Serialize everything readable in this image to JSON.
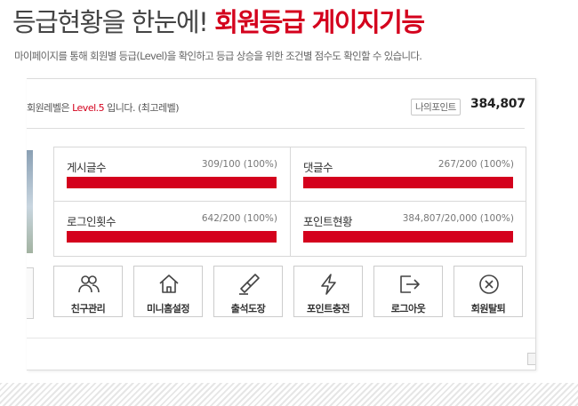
{
  "header": {
    "title_normal": "등급현황을 한눈에!",
    "title_accent": "회원등급 게이지기능",
    "subtitle": "마이페이지를 통해 회원별 등급(Level)을 확인하고 등급 상승을 위한 조건별 점수도 확인할 수 있습니다.",
    "accent_color": "#d4011d"
  },
  "member": {
    "level_prefix": "회원레벨은 ",
    "level_value": "Level.5",
    "level_suffix": " 입니다. (최고레벨)",
    "points_label": "나의포인트",
    "points_value": "384,807"
  },
  "stats": [
    {
      "label": "게시글수",
      "value": "309/100 (100%)",
      "percent": 100
    },
    {
      "label": "댓글수",
      "value": "267/200 (100%)",
      "percent": 100
    },
    {
      "label": "로그인횟수",
      "value": "642/200 (100%)",
      "percent": 100
    },
    {
      "label": "포인트현황",
      "value": "384,807/20,000 (100%)",
      "percent": 100
    }
  ],
  "actions": [
    {
      "label": "친구관리",
      "icon": "friends-icon"
    },
    {
      "label": "미니홈설정",
      "icon": "home-icon"
    },
    {
      "label": "출석도장",
      "icon": "stamp-icon"
    },
    {
      "label": "포인트충전",
      "icon": "lightning-icon"
    },
    {
      "label": "로그아웃",
      "icon": "logout-icon"
    },
    {
      "label": "회원탈퇴",
      "icon": "close-circle-icon"
    }
  ]
}
